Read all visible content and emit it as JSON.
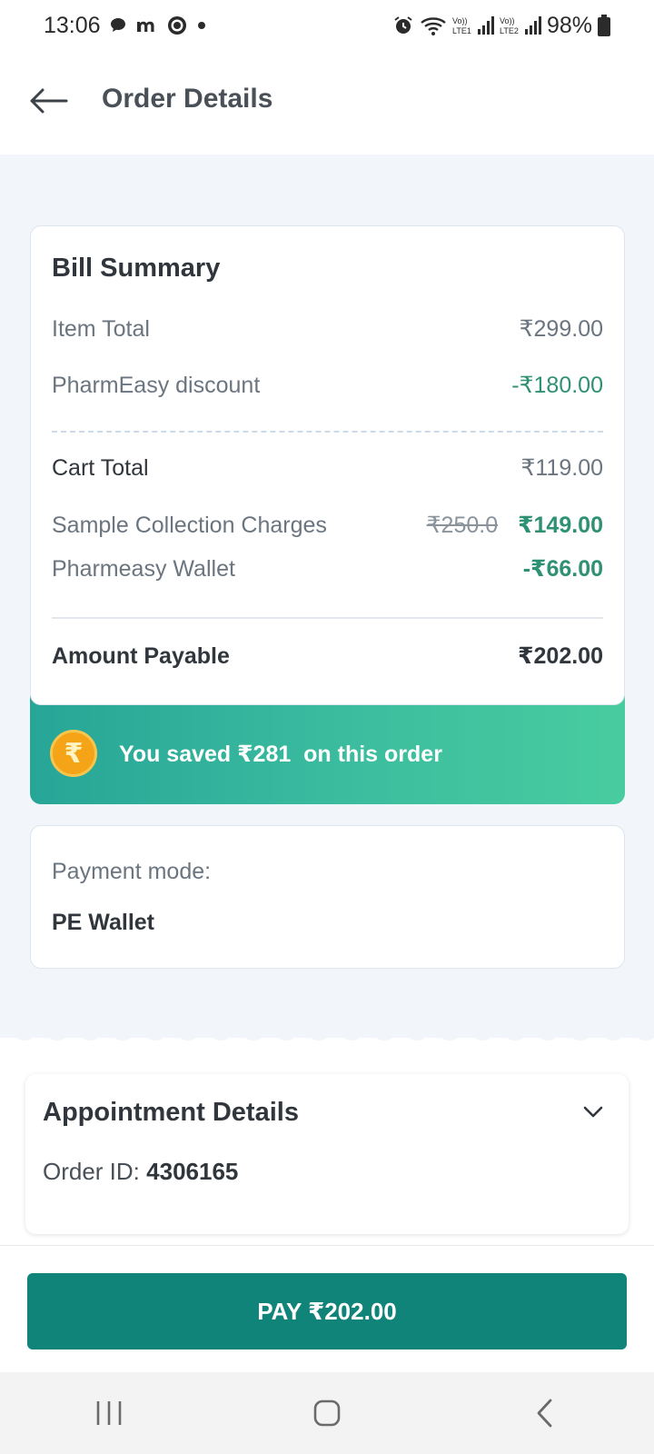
{
  "status_bar": {
    "time": "13:06",
    "battery": "98%",
    "icons": [
      "chat-icon",
      "m-icon",
      "whatsapp-icon",
      "dot-icon",
      "alarm-icon",
      "wifi-icon",
      "signal-lte1-icon",
      "signal-lte2-icon",
      "battery-icon"
    ]
  },
  "header": {
    "title": "Order Details",
    "back_icon": "arrow-left-icon"
  },
  "bill_summary": {
    "title": "Bill Summary",
    "item_total_label": "Item Total",
    "item_total_value": "₹299.00",
    "discount_label": "PharmEasy discount",
    "discount_value": "-₹180.00",
    "cart_total_label": "Cart Total",
    "cart_total_value": "₹119.00",
    "sample_label": "Sample Collection Charges",
    "sample_original": "₹250.0",
    "sample_value": "₹149.00",
    "wallet_label": "Pharmeasy Wallet",
    "wallet_value": "-₹66.00",
    "payable_label": "Amount Payable",
    "payable_value": "₹202.00"
  },
  "savings": {
    "text": "You saved ₹281  on this order",
    "coin_symbol": "₹"
  },
  "payment": {
    "label": "Payment mode:",
    "value": "PE Wallet"
  },
  "appointment": {
    "title": "Appointment Details",
    "order_id_label": "Order ID:",
    "order_id_value": "4306165"
  },
  "pay_button": {
    "label": "PAY ₹202.00"
  },
  "colors": {
    "accent": "#11847a",
    "green_text": "#2f9173",
    "banner_start": "#27a597",
    "banner_end": "#48cc9f",
    "coin": "#f5a417"
  }
}
